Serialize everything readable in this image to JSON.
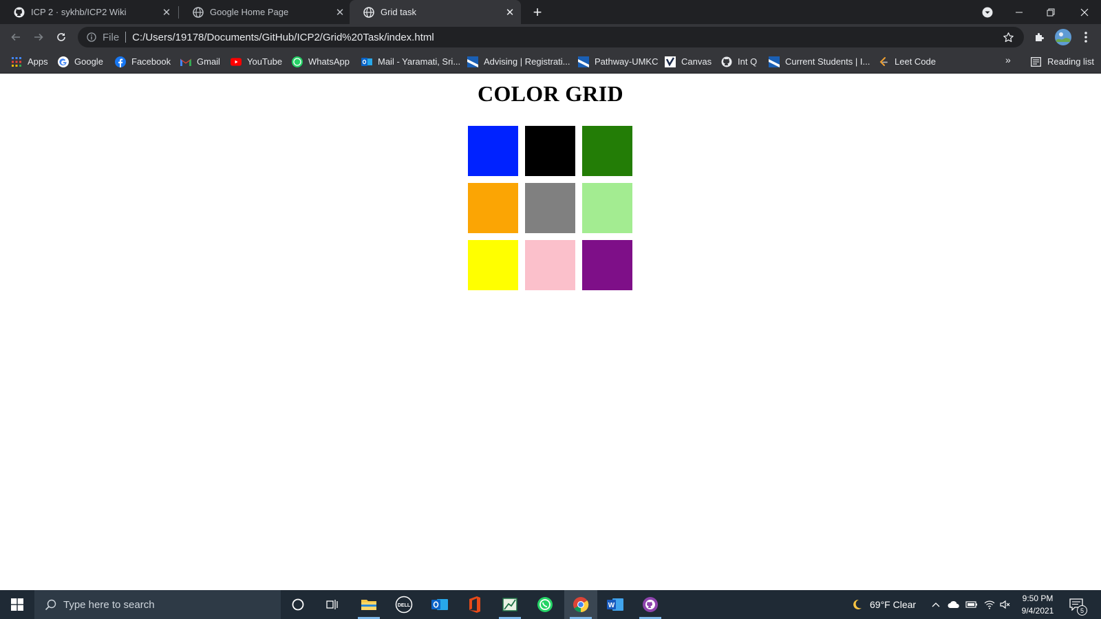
{
  "browser": {
    "tabs": [
      {
        "label": "ICP 2 · sykhb/ICP2 Wiki",
        "icon": "github-icon"
      },
      {
        "label": "Google Home Page",
        "icon": "globe-icon"
      },
      {
        "label": "Grid task",
        "icon": "globe-icon",
        "active": true
      }
    ],
    "omnibox": {
      "scheme_label": "File",
      "url": "C:/Users/19178/Documents/GitHub/ICP2/Grid%20Task/index.html"
    },
    "bookmarks": [
      {
        "label": "Apps",
        "icon": "apps-grid-icon"
      },
      {
        "label": "Google",
        "icon": "google-icon"
      },
      {
        "label": "Facebook",
        "icon": "facebook-icon"
      },
      {
        "label": "Gmail",
        "icon": "gmail-icon"
      },
      {
        "label": "YouTube",
        "icon": "youtube-icon"
      },
      {
        "label": "WhatsApp",
        "icon": "whatsapp-icon"
      },
      {
        "label": "Mail - Yaramati, Sri...",
        "icon": "outlook-icon"
      },
      {
        "label": "Advising | Registrati...",
        "icon": "umkc-icon"
      },
      {
        "label": "Pathway-UMKC",
        "icon": "umkc-icon"
      },
      {
        "label": "Canvas",
        "icon": "canvas-icon"
      },
      {
        "label": "Int Q",
        "icon": "github-icon"
      },
      {
        "label": "Current Students | I...",
        "icon": "umkc-icon"
      },
      {
        "label": "Leet Code",
        "icon": "leetcode-icon"
      }
    ],
    "bookmarks_overflow": "»",
    "reading_list": "Reading list"
  },
  "page": {
    "title": "COLOR GRID",
    "cells": [
      {
        "color": "#0022ff"
      },
      {
        "color": "#000000"
      },
      {
        "color": "#237d06"
      },
      {
        "color": "#fba504"
      },
      {
        "color": "#808080"
      },
      {
        "color": "#a3ec91"
      },
      {
        "color": "#ffff00"
      },
      {
        "color": "#fbc0cb"
      },
      {
        "color": "#7e0f88"
      }
    ]
  },
  "taskbar": {
    "search_placeholder": "Type here to search",
    "weather": "69°F Clear",
    "time": "9:50 PM",
    "date": "9/4/2021",
    "notification_count": "5",
    "apps": [
      "cortana-icon",
      "task-view-icon",
      "file-explorer-icon",
      "dell-icon",
      "outlook-icon",
      "office-icon",
      "excel-icon",
      "whatsapp-icon",
      "chrome-icon",
      "word-icon",
      "github-desktop-icon"
    ]
  },
  "colors": {
    "tab_strip": "#202124",
    "toolbar": "#35363a",
    "taskbar": "#1f2a35"
  }
}
